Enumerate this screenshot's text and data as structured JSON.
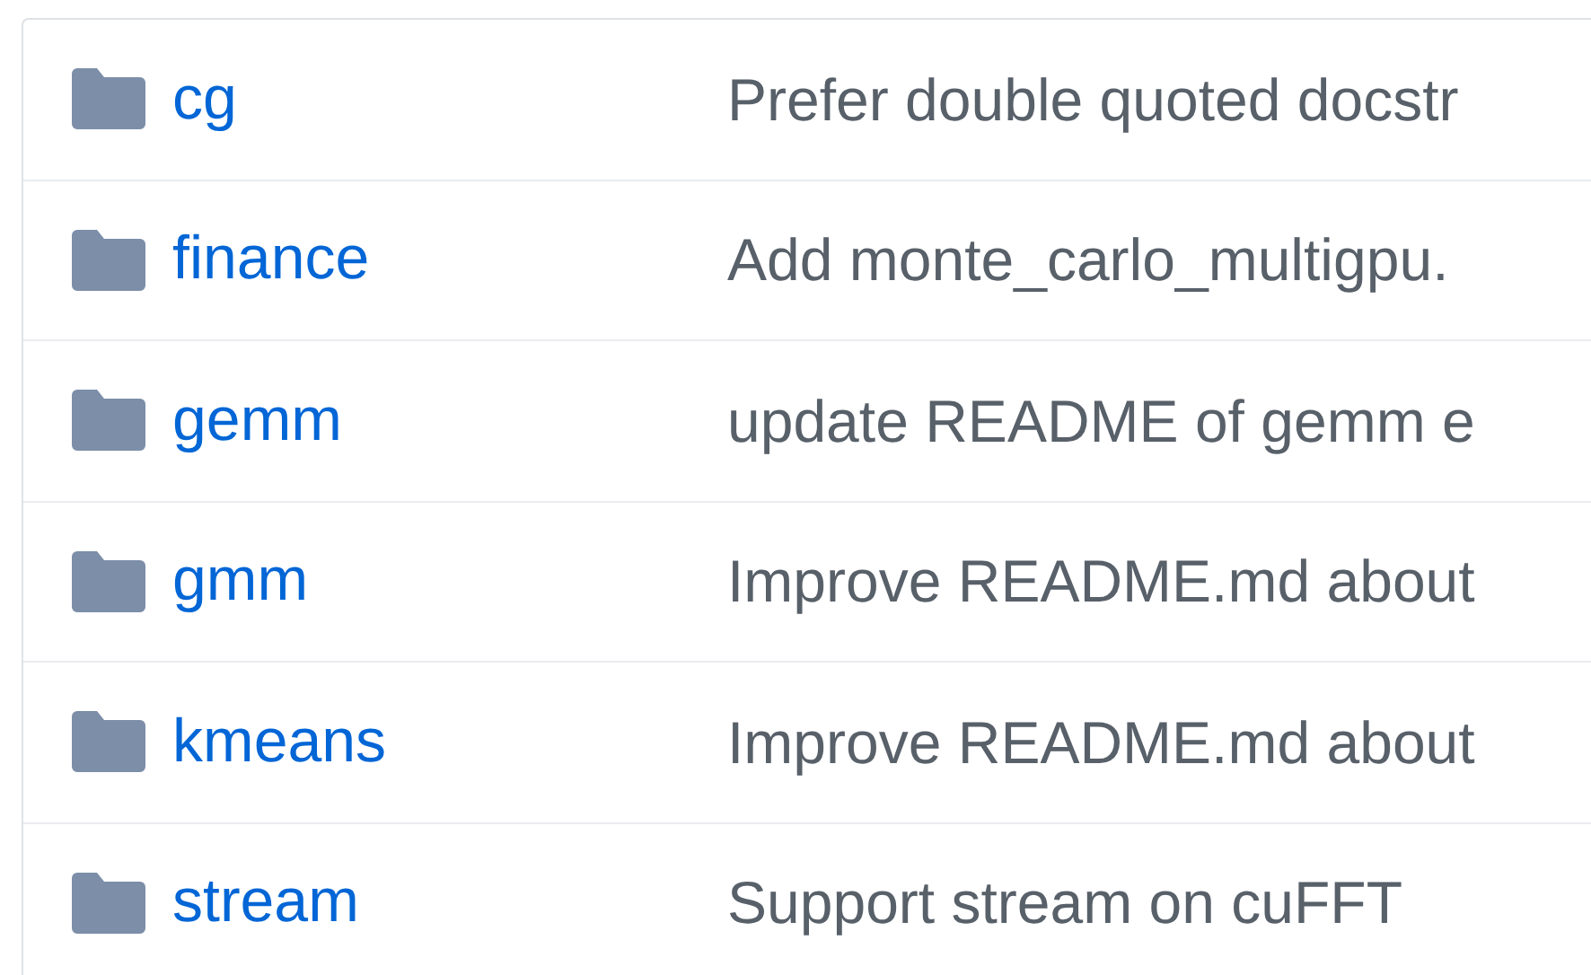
{
  "files": [
    {
      "name": "cg",
      "message": "Prefer double quoted docstr"
    },
    {
      "name": "finance",
      "message": "Add monte_carlo_multigpu."
    },
    {
      "name": "gemm",
      "message": "update README of gemm e"
    },
    {
      "name": "gmm",
      "message": "Improve README.md about"
    },
    {
      "name": "kmeans",
      "message": "Improve README.md about"
    },
    {
      "name": "stream",
      "message": "Support stream on cuFFT"
    }
  ]
}
